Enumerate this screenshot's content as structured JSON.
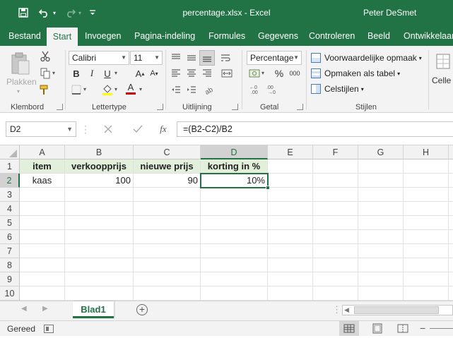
{
  "window": {
    "title": "percentage.xlsx - Excel",
    "user": "Peter DeSmet"
  },
  "tabs": [
    "Bestand",
    "Start",
    "Invoegen",
    "Pagina-indeling",
    "Formules",
    "Gegevens",
    "Controleren",
    "Beeld",
    "Ontwikkelaar"
  ],
  "active_tab": "Start",
  "ribbon": {
    "clipboard": {
      "paste_label": "Plakken",
      "group_label": "Klembord"
    },
    "font": {
      "name": "Calibri",
      "size": "11",
      "group_label": "Lettertype",
      "bold": "B",
      "italic": "I",
      "underline": "U",
      "font_color_letter": "A",
      "font_color": "#c00000"
    },
    "alignment": {
      "group_label": "Uitlijning"
    },
    "number": {
      "format": "Percentage",
      "percent_symbol": "%",
      "thousands_symbol": "000",
      "group_label": "Getal"
    },
    "styles": {
      "conditional": "Voorwaardelijke opmaak",
      "format_table": "Opmaken als tabel",
      "cell_styles": "Celstijlen",
      "group_label": "Stijlen"
    },
    "cells_label": "Celle"
  },
  "formula_bar": {
    "name_box": "D2",
    "formula": "=(B2-C2)/B2",
    "fx": "fx"
  },
  "grid": {
    "columns": [
      "A",
      "B",
      "C",
      "D",
      "E",
      "F",
      "G",
      "H"
    ],
    "rows": [
      "1",
      "2",
      "3",
      "4",
      "5",
      "6",
      "7",
      "8",
      "9",
      "10"
    ],
    "selected_column": "D",
    "selected_row": "2",
    "headers": {
      "a1": "item",
      "b1": "verkoopprijs",
      "c1": "nieuwe prijs",
      "d1": "korting in %"
    },
    "row2": {
      "a2": "kaas",
      "b2": "100",
      "c2": "90",
      "d2": "10%"
    }
  },
  "sheets": [
    "Blad1"
  ],
  "status": "Gereed",
  "colors": {
    "accent": "#217346",
    "header_fill": "#e2efda"
  }
}
